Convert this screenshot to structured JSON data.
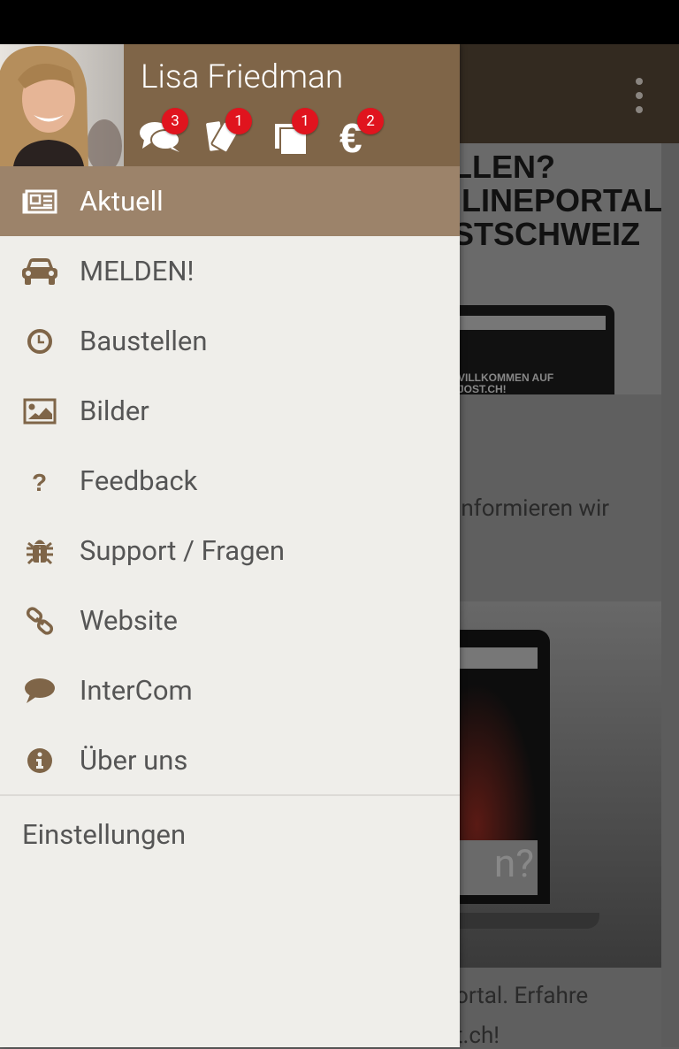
{
  "user": {
    "name": "Lisa Friedman"
  },
  "header_icons": [
    {
      "icon": "chat-bubbles-icon",
      "badge": "3"
    },
    {
      "icon": "tickets-icon",
      "badge": "1"
    },
    {
      "icon": "documents-icon",
      "badge": "1"
    },
    {
      "icon": "euro-icon",
      "badge": "2"
    }
  ],
  "menu": [
    {
      "label": "Aktuell",
      "icon": "newspaper-icon",
      "active": true
    },
    {
      "label": "MELDEN!",
      "icon": "car-icon"
    },
    {
      "label": "Baustellen",
      "icon": "clock-icon"
    },
    {
      "label": "Bilder",
      "icon": "image-icon"
    },
    {
      "label": "Feedback",
      "icon": "question-icon"
    },
    {
      "label": "Support / Fragen",
      "icon": "bug-icon"
    },
    {
      "label": "Website",
      "icon": "link-icon"
    },
    {
      "label": "InterCom",
      "icon": "comment-icon"
    },
    {
      "label": "Über uns",
      "icon": "info-icon"
    }
  ],
  "settings_label": "Einstellungen",
  "background": {
    "hero_title": "LLEN?\nILINEPORTAL\nSTSCHWEIZ",
    "laptop_text": "VILLKOMMEN AUF\nJOST.CH!",
    "text1": "informieren wir",
    "text2": ".",
    "laptop_q": "n?",
    "text3": "ortal. Erfahre",
    "text4": "t.ch!"
  },
  "colors": {
    "header": "#7f6548",
    "active": "#9c836a",
    "icon": "#7f6548",
    "badge": "#e0141e",
    "toolbar": "#332a20"
  }
}
